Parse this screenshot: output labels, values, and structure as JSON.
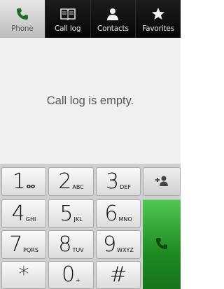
{
  "tabs": [
    {
      "label": "Phone",
      "icon": "phone-icon",
      "active": true
    },
    {
      "label": "Call log",
      "icon": "book-icon",
      "active": false
    },
    {
      "label": "Contacts",
      "icon": "person-icon",
      "active": false
    },
    {
      "label": "Favorites",
      "icon": "star-icon",
      "active": false
    }
  ],
  "content": {
    "empty_message": "Call log is empty."
  },
  "dialpad": {
    "keys": [
      {
        "digit": "1",
        "sub": "oo"
      },
      {
        "digit": "2",
        "sub": "ABC"
      },
      {
        "digit": "3",
        "sub": "DEF"
      },
      {
        "digit": "4",
        "sub": "GHI"
      },
      {
        "digit": "5",
        "sub": "JKL"
      },
      {
        "digit": "6",
        "sub": "MNO"
      },
      {
        "digit": "7",
        "sub": "PQRS"
      },
      {
        "digit": "8",
        "sub": "TUV"
      },
      {
        "digit": "9",
        "sub": "WXYZ"
      },
      {
        "digit": "*",
        "sub": ""
      },
      {
        "digit": "0",
        "sub": "+"
      },
      {
        "digit": "#",
        "sub": ""
      }
    ],
    "add_contact_icon": "add-contact-icon",
    "call_icon": "call-icon"
  },
  "colors": {
    "call_green": "#2ea832",
    "tab_active": "#d6d6d6",
    "background": "#f0f0f0"
  }
}
